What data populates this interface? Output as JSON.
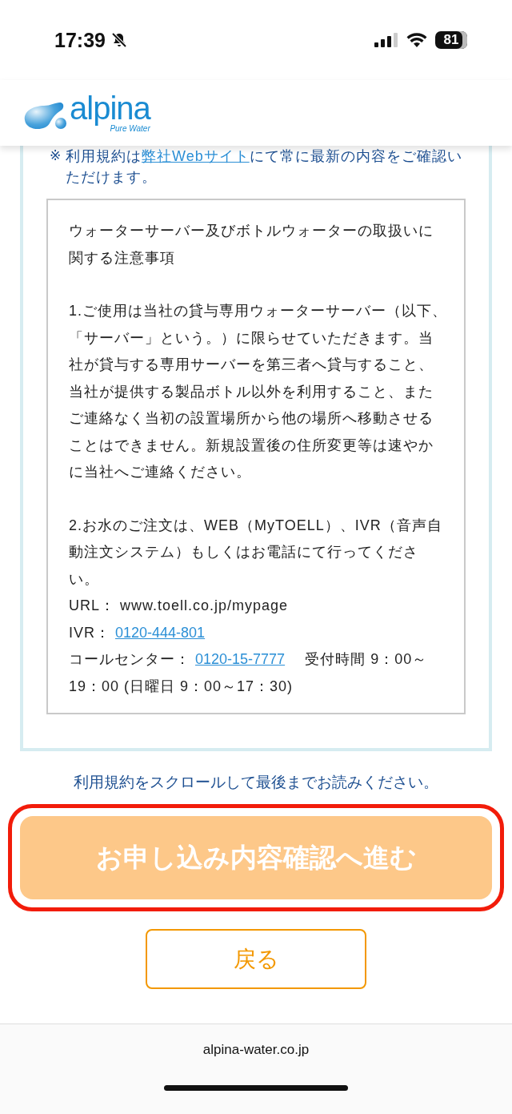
{
  "status_bar": {
    "time": "17:39",
    "silent": true,
    "battery": "81"
  },
  "header": {
    "logo_name": "alpina",
    "logo_tagline": "Pure Water"
  },
  "terms_notice": {
    "mark": "※",
    "before": "利用規約は",
    "link": "弊社Webサイト",
    "after": "にて常に最新の内容をご確認いただけます。"
  },
  "terms_box": {
    "title": "ウォーターサーバー及びボトルウォーターの取扱いに関する注意事項",
    "clause_1": "1.ご使用は当社の貸与専用ウォーターサーバー（以下、「サーバー」という。）に限らせていただきます。当社が貸与する専用サーバーを第三者へ貸与すること、当社が提供する製品ボトル以外を利用すること、またご連絡なく当初の設置場所から他の場所へ移動させることはできません。新規設置後の住所変更等は速やかに当社へご連絡ください。",
    "clause_2": "2.お水のご注文は、WEB（MyTOELL）、IVR（音声自動注文システム）もしくはお電話にて行ってください。",
    "url_line": "URL： www.toell.co.jp/mypage",
    "ivr": {
      "label": "IVR：",
      "number": "0120-444-801"
    },
    "call_center": {
      "label": "コールセンター：",
      "number": "0120-15-7777",
      "hours": "受付時間 9：00～19：00 (日曜日 9：00～17：30)"
    }
  },
  "scroll_instruction": "利用規約をスクロールして最後までお読みください。",
  "proceed_button": {
    "label": "お申し込み内容確認へ進む",
    "disabled": true,
    "highlighted": true
  },
  "back_button": {
    "label": "戻る"
  },
  "browser_bar": {
    "url": "alpina-water.co.jp"
  }
}
